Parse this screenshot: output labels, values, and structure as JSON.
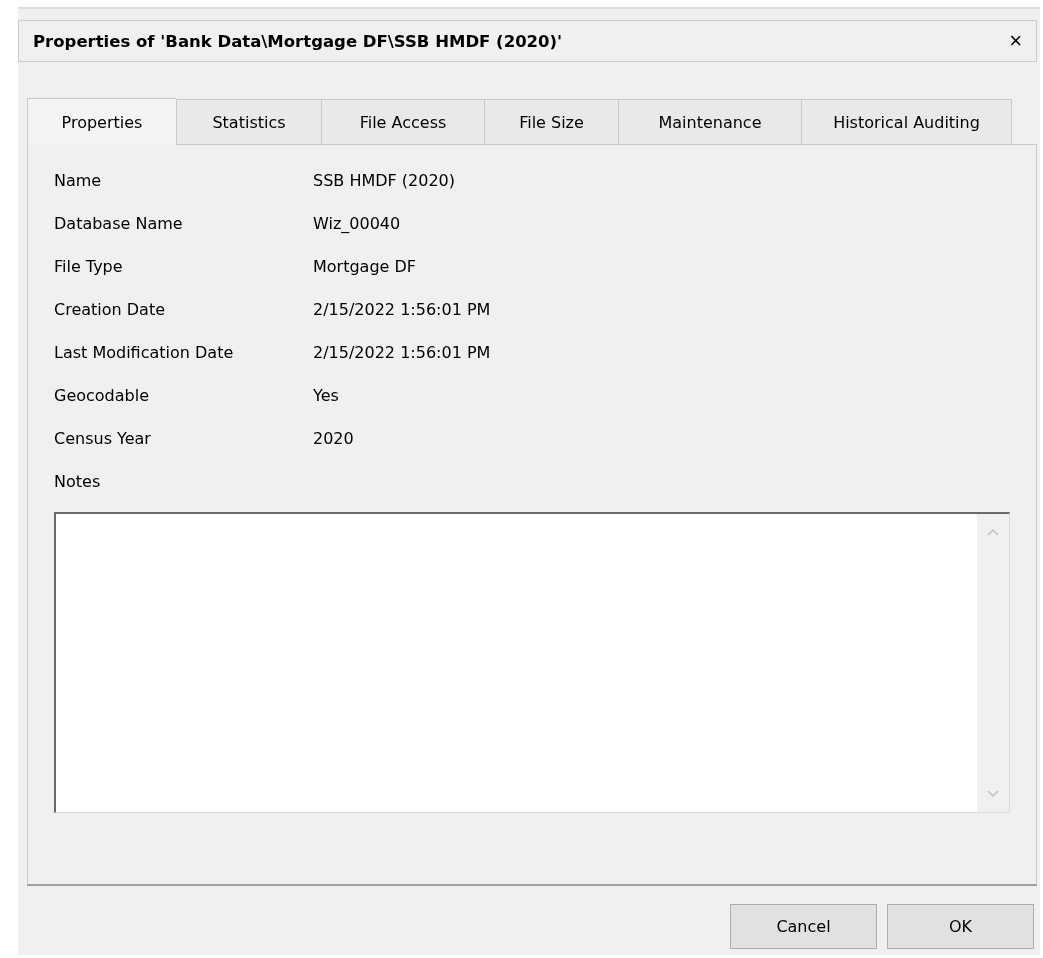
{
  "window": {
    "title": "Properties of 'Bank Data\\Mortgage DF\\SSB HMDF (2020)'",
    "close": "×"
  },
  "tabs": [
    {
      "label": "Properties",
      "selected": true
    },
    {
      "label": "Statistics",
      "selected": false
    },
    {
      "label": "File Access",
      "selected": false
    },
    {
      "label": "File Size",
      "selected": false
    },
    {
      "label": "Maintenance",
      "selected": false
    },
    {
      "label": "Historical Auditing",
      "selected": false
    }
  ],
  "properties": [
    {
      "label": "Name",
      "value": "SSB HMDF (2020)"
    },
    {
      "label": "Database Name",
      "value": "Wiz_00040"
    },
    {
      "label": "File Type",
      "value": "Mortgage DF"
    },
    {
      "label": "Creation Date",
      "value": "2/15/2022 1:56:01 PM"
    },
    {
      "label": "Last Modification Date",
      "value": "2/15/2022 1:56:01 PM"
    },
    {
      "label": "Geocodable",
      "value": "Yes"
    },
    {
      "label": "Census Year",
      "value": "2020"
    }
  ],
  "notes": {
    "label": "Notes"
  },
  "buttons": [
    "Cancel",
    "OK"
  ]
}
